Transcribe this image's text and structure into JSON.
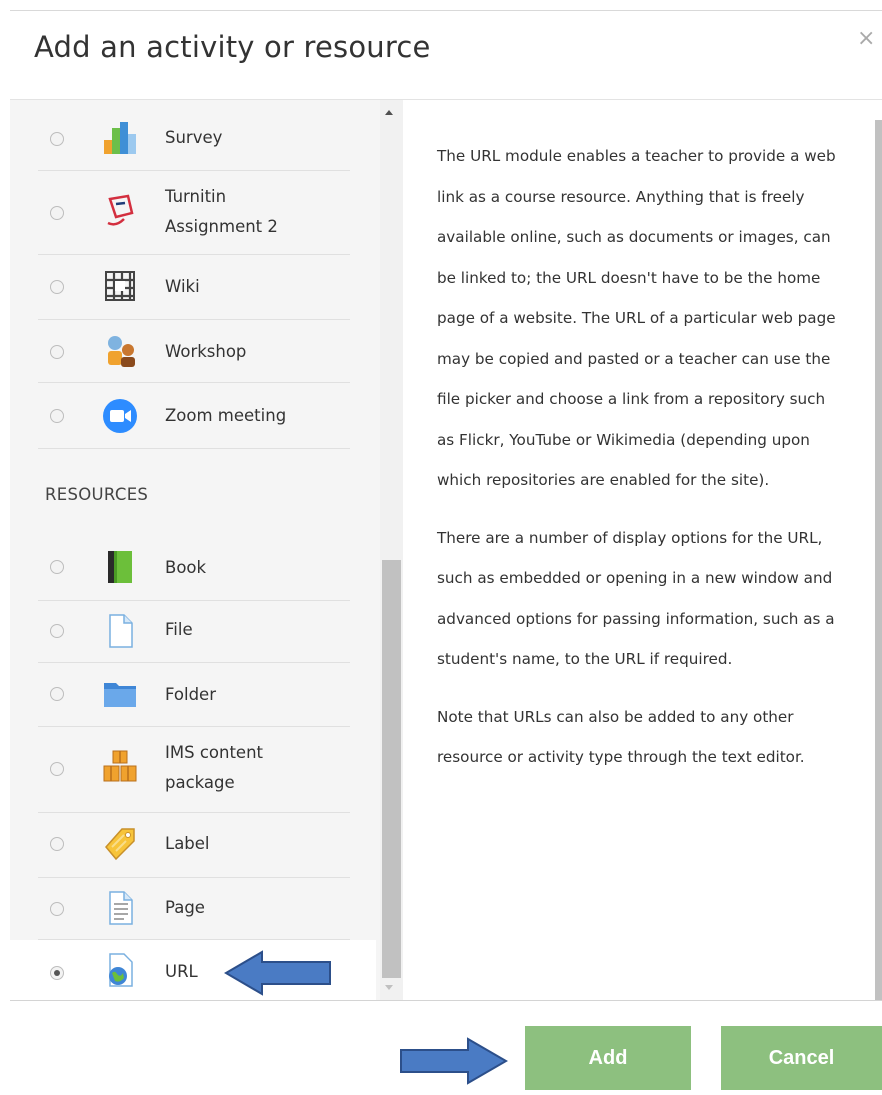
{
  "dialog": {
    "title": "Add an activity or resource",
    "close_label": "×"
  },
  "activities": [
    {
      "label": "Survey",
      "icon": "survey-icon"
    },
    {
      "label": "Turnitin Assignment 2",
      "label_lines": [
        "Turnitin",
        "Assignment 2"
      ],
      "icon": "turnitin-icon"
    },
    {
      "label": "Wiki",
      "icon": "wiki-icon"
    },
    {
      "label": "Workshop",
      "icon": "workshop-icon"
    },
    {
      "label": "Zoom meeting",
      "icon": "zoom-icon"
    }
  ],
  "resources_heading": "RESOURCES",
  "resources": [
    {
      "label": "Book",
      "icon": "book-icon"
    },
    {
      "label": "File",
      "icon": "file-icon"
    },
    {
      "label": "Folder",
      "icon": "folder-icon"
    },
    {
      "label": "IMS content package",
      "label_lines": [
        "IMS content",
        "package"
      ],
      "icon": "ims-package-icon"
    },
    {
      "label": "Label",
      "icon": "label-tag-icon"
    },
    {
      "label": "Page",
      "icon": "page-icon"
    },
    {
      "label": "URL",
      "icon": "url-globe-icon",
      "selected": true
    }
  ],
  "description": {
    "paragraphs": [
      "The URL module enables a teacher to provide a web link as a course resource. Anything that is freely available online, such as documents or images, can be linked to; the URL doesn't have to be the home page of a website. The URL of a particular web page may be copied and pasted or a teacher can use the file picker and choose a link from a repository such as Flickr, YouTube or Wikimedia (depending upon which repositories are enabled for the site).",
      "There are a number of display options for the URL, such as embedded or opening in a new window and advanced options for passing information, such as a student's name, to the URL if required.",
      "Note that URLs can also be added to any other resource or activity type through the text editor."
    ]
  },
  "buttons": {
    "add": "Add",
    "cancel": "Cancel"
  },
  "colors": {
    "button_green": "#8dc07f",
    "annotation_arrow": "#4a7bc4"
  }
}
